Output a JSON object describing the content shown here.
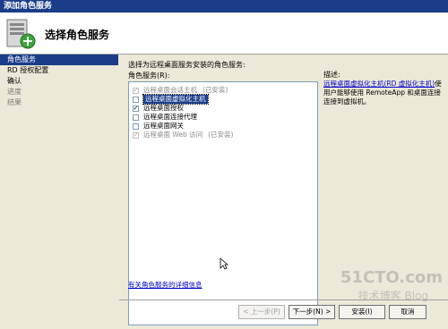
{
  "window": {
    "title": "添加角色服务"
  },
  "header": {
    "title": "选择角色服务",
    "icon": "server-add-icon"
  },
  "sidebar": {
    "items": [
      {
        "label": "角色服务",
        "state": "selected"
      },
      {
        "label": "RD 授权配置",
        "state": "normal"
      },
      {
        "label": "确认",
        "state": "normal"
      },
      {
        "label": "进度",
        "state": "inactive"
      },
      {
        "label": "结果",
        "state": "inactive"
      }
    ]
  },
  "main": {
    "instruction": "选择为远程桌面服务安装的角色服务:",
    "list_label": "角色服务(R):",
    "roles": [
      {
        "label": "远程桌面会话主机",
        "checked": true,
        "disabled": true,
        "status": "(已安装)"
      },
      {
        "label": "远程桌面虚拟化主机",
        "checked": false,
        "disabled": false,
        "status": "",
        "highlighted": true
      },
      {
        "label": "远程桌面授权",
        "checked": true,
        "disabled": false,
        "status": ""
      },
      {
        "label": "远程桌面连接代理",
        "checked": false,
        "disabled": false,
        "status": ""
      },
      {
        "label": "远程桌面网关",
        "checked": false,
        "disabled": false,
        "status": ""
      },
      {
        "label": "远程桌面 Web 访问",
        "checked": true,
        "disabled": true,
        "status": "(已安装)"
      }
    ],
    "more_link": "有关角色服务的详细信息"
  },
  "description": {
    "title": "描述:",
    "link": "远程桌面虚拟化主机(RD 虚拟化主机)",
    "text": "使用户能够使用 RemoteApp 和桌面连接连接到虚拟机。"
  },
  "buttons": {
    "prev": "< 上一步(P)",
    "next": "下一步(N) >",
    "install": "安装(I)",
    "cancel": "取消"
  },
  "watermark": {
    "line1": "51CTO.com",
    "line2": "技术博客 Blog"
  }
}
